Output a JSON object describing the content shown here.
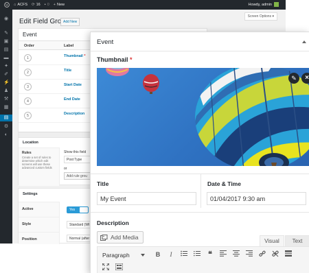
{
  "admin_bar": {
    "site_name": "ACFS",
    "updates_count": "16",
    "comments_count": "0",
    "new_label": "New",
    "howdy": "Howdy, admin"
  },
  "page": {
    "title": "Edit Field Group",
    "add_new_label": "Add New",
    "screen_options_label": "Screen Options ▾"
  },
  "field_group": {
    "title": "Event",
    "columns": [
      "Order",
      "Label"
    ],
    "fields": [
      {
        "order": "1",
        "label": "Thumbnail",
        "required_mark": "*"
      },
      {
        "order": "2",
        "label": "Title",
        "required_mark": ""
      },
      {
        "order": "3",
        "label": "Start Date",
        "required_mark": ""
      },
      {
        "order": "4",
        "label": "End Date",
        "required_mark": ""
      },
      {
        "order": "5",
        "label": "Description",
        "required_mark": ""
      }
    ]
  },
  "location": {
    "title": "Location",
    "rules_label": "Rules",
    "rules_description": "Create a set of rules to determine which edit screens will use these advanced custom fields",
    "show_if_label": "Show this field",
    "param_value": "Post Type",
    "or_label": "or",
    "add_rule_label": "Add rule grou"
  },
  "settings": {
    "title": "Settings",
    "active_label": "Active",
    "active_value": "Yes",
    "style_label": "Style",
    "style_value": "Standard (WI",
    "position_label": "Position",
    "position_value": "Normal (after"
  },
  "popup": {
    "title": "Event",
    "thumbnail_label": "Thumbnail",
    "required_mark": "*",
    "title_label": "Title",
    "title_value": "My Event",
    "date_label": "Date & Time",
    "date_value": "01/04/2017 9:30 am",
    "description_label": "Description",
    "add_media_label": "Add Media",
    "tab_visual": "Visual",
    "tab_text": "Text",
    "format_value": "Paragraph"
  },
  "icons": {
    "edit": "✎",
    "remove": "×",
    "bold": "B",
    "italic": "I",
    "quote": "❝",
    "link": "🔗"
  },
  "colors": {
    "admin_bar": "#23282d",
    "accent": "#0073aa",
    "required": "#dc3232",
    "toggle": "#2a9bd7"
  }
}
